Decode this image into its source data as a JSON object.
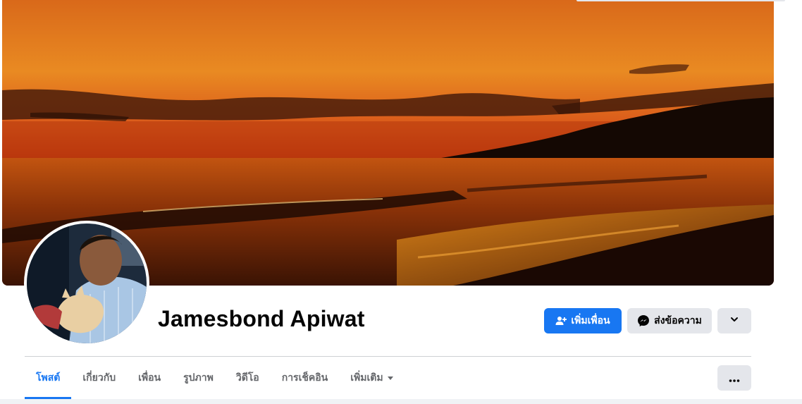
{
  "profile": {
    "name": "Jamesbond Apiwat"
  },
  "actions": {
    "add_friend_label": "เพิ่มเพื่อน",
    "message_label": "ส่งข้อความ",
    "add_friend_icon": "add-friend-icon",
    "message_icon": "messenger-icon",
    "more_icon": "chevron-down-icon"
  },
  "tabs": [
    {
      "label": "โพสต์",
      "active": true
    },
    {
      "label": "เกี่ยวกับ",
      "active": false
    },
    {
      "label": "เพื่อน",
      "active": false
    },
    {
      "label": "รูปภาพ",
      "active": false
    },
    {
      "label": "วิดีโอ",
      "active": false
    },
    {
      "label": "การเช็คอิน",
      "active": false
    },
    {
      "label": "เพิ่มเติม",
      "active": false,
      "dropdown": true
    }
  ],
  "tab_options_icon": "ellipsis-icon",
  "colors": {
    "brand_blue": "#1877f2",
    "button_gray": "#e4e6eb",
    "muted_text": "#65676b",
    "divider": "#ced0d4",
    "cover_sky_top": "#e3701a",
    "cover_sky_glow": "#c2360e",
    "cover_sea": "#5a1f06"
  }
}
